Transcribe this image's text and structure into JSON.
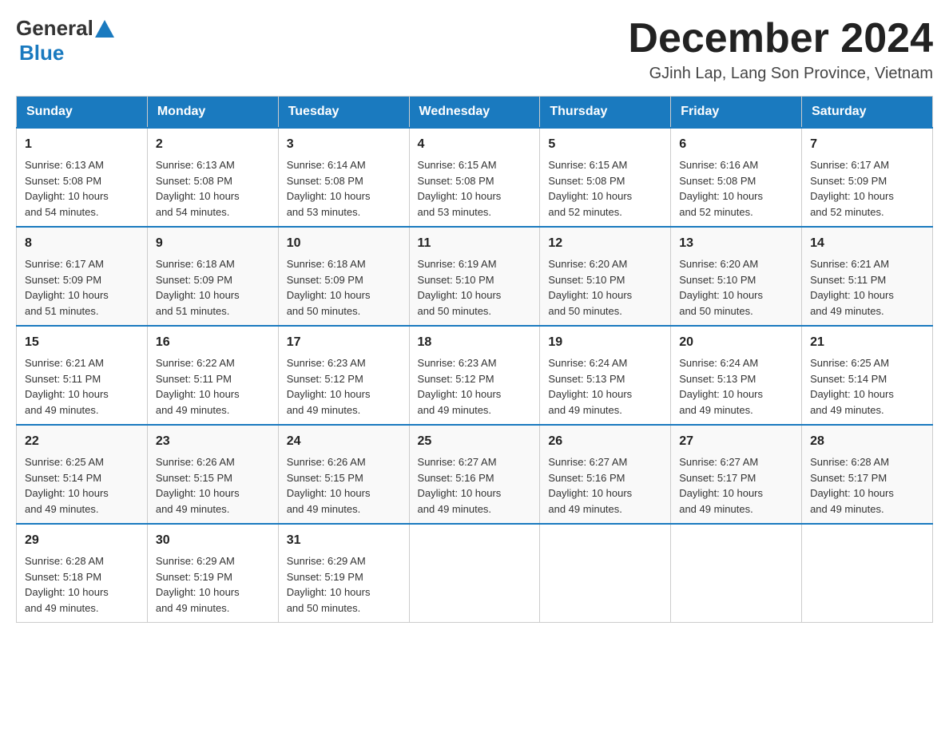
{
  "header": {
    "logo_general": "General",
    "logo_blue": "Blue",
    "month_title": "December 2024",
    "location": "GJinh Lap, Lang Son Province, Vietnam"
  },
  "days_of_week": [
    "Sunday",
    "Monday",
    "Tuesday",
    "Wednesday",
    "Thursday",
    "Friday",
    "Saturday"
  ],
  "weeks": [
    [
      {
        "day": "1",
        "sunrise": "6:13 AM",
        "sunset": "5:08 PM",
        "daylight": "10 hours and 54 minutes."
      },
      {
        "day": "2",
        "sunrise": "6:13 AM",
        "sunset": "5:08 PM",
        "daylight": "10 hours and 54 minutes."
      },
      {
        "day": "3",
        "sunrise": "6:14 AM",
        "sunset": "5:08 PM",
        "daylight": "10 hours and 53 minutes."
      },
      {
        "day": "4",
        "sunrise": "6:15 AM",
        "sunset": "5:08 PM",
        "daylight": "10 hours and 53 minutes."
      },
      {
        "day": "5",
        "sunrise": "6:15 AM",
        "sunset": "5:08 PM",
        "daylight": "10 hours and 52 minutes."
      },
      {
        "day": "6",
        "sunrise": "6:16 AM",
        "sunset": "5:08 PM",
        "daylight": "10 hours and 52 minutes."
      },
      {
        "day": "7",
        "sunrise": "6:17 AM",
        "sunset": "5:09 PM",
        "daylight": "10 hours and 52 minutes."
      }
    ],
    [
      {
        "day": "8",
        "sunrise": "6:17 AM",
        "sunset": "5:09 PM",
        "daylight": "10 hours and 51 minutes."
      },
      {
        "day": "9",
        "sunrise": "6:18 AM",
        "sunset": "5:09 PM",
        "daylight": "10 hours and 51 minutes."
      },
      {
        "day": "10",
        "sunrise": "6:18 AM",
        "sunset": "5:09 PM",
        "daylight": "10 hours and 50 minutes."
      },
      {
        "day": "11",
        "sunrise": "6:19 AM",
        "sunset": "5:10 PM",
        "daylight": "10 hours and 50 minutes."
      },
      {
        "day": "12",
        "sunrise": "6:20 AM",
        "sunset": "5:10 PM",
        "daylight": "10 hours and 50 minutes."
      },
      {
        "day": "13",
        "sunrise": "6:20 AM",
        "sunset": "5:10 PM",
        "daylight": "10 hours and 50 minutes."
      },
      {
        "day": "14",
        "sunrise": "6:21 AM",
        "sunset": "5:11 PM",
        "daylight": "10 hours and 49 minutes."
      }
    ],
    [
      {
        "day": "15",
        "sunrise": "6:21 AM",
        "sunset": "5:11 PM",
        "daylight": "10 hours and 49 minutes."
      },
      {
        "day": "16",
        "sunrise": "6:22 AM",
        "sunset": "5:11 PM",
        "daylight": "10 hours and 49 minutes."
      },
      {
        "day": "17",
        "sunrise": "6:23 AM",
        "sunset": "5:12 PM",
        "daylight": "10 hours and 49 minutes."
      },
      {
        "day": "18",
        "sunrise": "6:23 AM",
        "sunset": "5:12 PM",
        "daylight": "10 hours and 49 minutes."
      },
      {
        "day": "19",
        "sunrise": "6:24 AM",
        "sunset": "5:13 PM",
        "daylight": "10 hours and 49 minutes."
      },
      {
        "day": "20",
        "sunrise": "6:24 AM",
        "sunset": "5:13 PM",
        "daylight": "10 hours and 49 minutes."
      },
      {
        "day": "21",
        "sunrise": "6:25 AM",
        "sunset": "5:14 PM",
        "daylight": "10 hours and 49 minutes."
      }
    ],
    [
      {
        "day": "22",
        "sunrise": "6:25 AM",
        "sunset": "5:14 PM",
        "daylight": "10 hours and 49 minutes."
      },
      {
        "day": "23",
        "sunrise": "6:26 AM",
        "sunset": "5:15 PM",
        "daylight": "10 hours and 49 minutes."
      },
      {
        "day": "24",
        "sunrise": "6:26 AM",
        "sunset": "5:15 PM",
        "daylight": "10 hours and 49 minutes."
      },
      {
        "day": "25",
        "sunrise": "6:27 AM",
        "sunset": "5:16 PM",
        "daylight": "10 hours and 49 minutes."
      },
      {
        "day": "26",
        "sunrise": "6:27 AM",
        "sunset": "5:16 PM",
        "daylight": "10 hours and 49 minutes."
      },
      {
        "day": "27",
        "sunrise": "6:27 AM",
        "sunset": "5:17 PM",
        "daylight": "10 hours and 49 minutes."
      },
      {
        "day": "28",
        "sunrise": "6:28 AM",
        "sunset": "5:17 PM",
        "daylight": "10 hours and 49 minutes."
      }
    ],
    [
      {
        "day": "29",
        "sunrise": "6:28 AM",
        "sunset": "5:18 PM",
        "daylight": "10 hours and 49 minutes."
      },
      {
        "day": "30",
        "sunrise": "6:29 AM",
        "sunset": "5:19 PM",
        "daylight": "10 hours and 49 minutes."
      },
      {
        "day": "31",
        "sunrise": "6:29 AM",
        "sunset": "5:19 PM",
        "daylight": "10 hours and 50 minutes."
      },
      null,
      null,
      null,
      null
    ]
  ],
  "labels": {
    "sunrise": "Sunrise:",
    "sunset": "Sunset:",
    "daylight": "Daylight:"
  }
}
